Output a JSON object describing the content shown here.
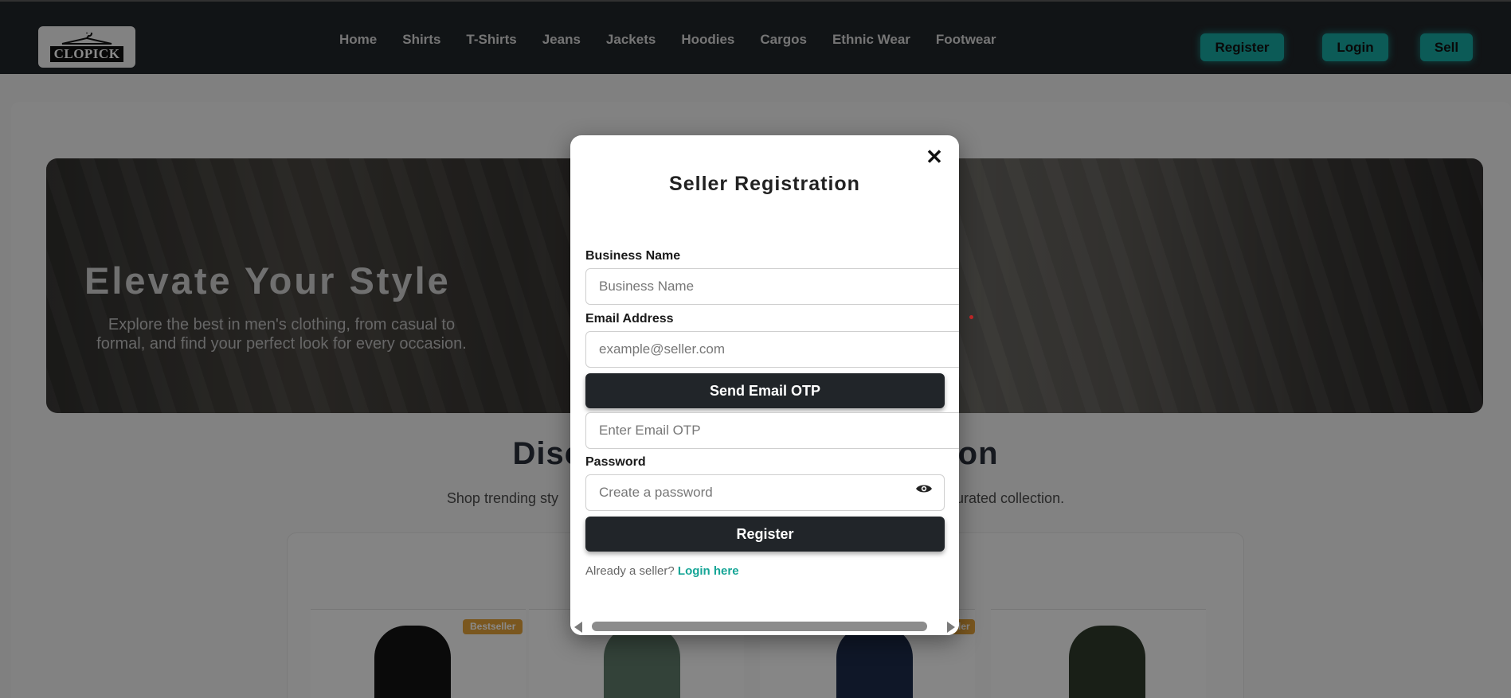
{
  "brand": {
    "logo_text": "CLOPICK"
  },
  "nav": {
    "links": [
      "Home",
      "Shirts",
      "T-Shirts",
      "Jeans",
      "Jackets",
      "Hoodies",
      "Cargos",
      "Ethnic Wear",
      "Footwear"
    ],
    "register_label": "Register",
    "login_label": "Login",
    "sell_label": "Sell"
  },
  "hero": {
    "title": "Elevate Your Style",
    "subtitle": "Explore the best in men's clothing, from casual to formal, and find your perfect look for every occasion."
  },
  "section": {
    "title_left": "Discov",
    "title_right": "ashion",
    "subtitle_left": "Shop trending sty",
    "subtitle_right": "curated collection."
  },
  "products": {
    "badges": [
      "Bestseller",
      "eller"
    ]
  },
  "modal": {
    "title": "Seller Registration",
    "close_symbol": "✕",
    "business_label": "Business Name",
    "business_placeholder": "Business Name",
    "email_label": "Email Address",
    "email_placeholder": "example@seller.com",
    "send_otp_label": "Send Email OTP",
    "otp_placeholder": "Enter Email OTP",
    "password_label": "Password",
    "password_placeholder": "Create a password",
    "register_label": "Register",
    "already_text": "Already a seller?",
    "login_link": "Login here"
  },
  "colors": {
    "nav_bg": "#212529",
    "accent_teal": "#17a8a2",
    "button_dark": "#212529",
    "link_teal": "#15a596",
    "badge_orange": "#e2a23a"
  },
  "icons": {
    "close": "close-icon",
    "password_toggle": "eye-icon",
    "scroll_left": "scroll-left-arrow-icon",
    "scroll_right": "scroll-right-arrow-icon"
  }
}
